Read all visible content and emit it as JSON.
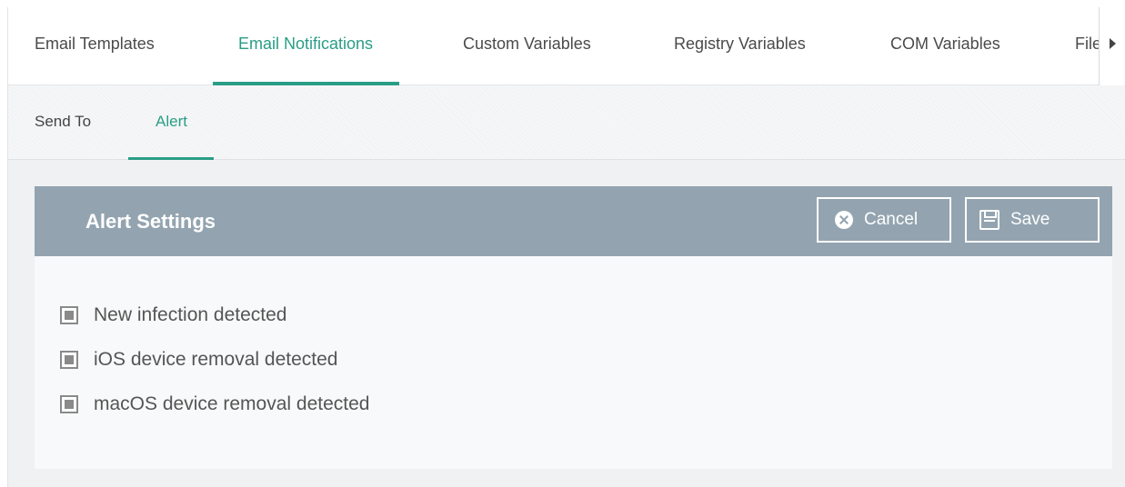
{
  "top_tabs": [
    {
      "label": "Email Templates",
      "active": false
    },
    {
      "label": "Email Notifications",
      "active": true
    },
    {
      "label": "Custom Variables",
      "active": false
    },
    {
      "label": "Registry Variables",
      "active": false
    },
    {
      "label": "COM Variables",
      "active": false
    },
    {
      "label": "File",
      "active": false
    }
  ],
  "sub_tabs": [
    {
      "label": "Send To",
      "active": false
    },
    {
      "label": "Alert",
      "active": true
    }
  ],
  "panel": {
    "title": "Alert Settings",
    "cancel_label": "Cancel",
    "save_label": "Save"
  },
  "options": [
    {
      "label": "New infection detected",
      "state": "indeterminate"
    },
    {
      "label": "iOS device removal detected",
      "state": "indeterminate"
    },
    {
      "label": "macOS device removal detected",
      "state": "indeterminate"
    }
  ],
  "icons": {
    "cancel": "x-circle-icon",
    "save": "floppy-disk-icon",
    "overflow": "chevron-right-icon"
  },
  "colors": {
    "accent": "#2a9d87",
    "panel_header": "#93a4b0"
  }
}
